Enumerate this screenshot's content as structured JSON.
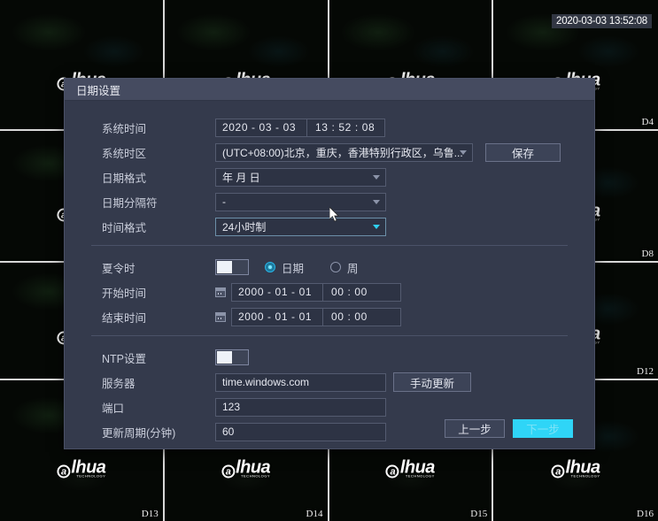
{
  "video_wall": {
    "osd_timestamp": "2020-03-03 13:52:08",
    "logo_text": "lhua",
    "logo_mark": "a",
    "logo_sub": "TECHNOLOGY",
    "channels": [
      {
        "label": ""
      },
      {
        "label": ""
      },
      {
        "label": ""
      },
      {
        "label": "D4"
      },
      {
        "label": ""
      },
      {
        "label": ""
      },
      {
        "label": ""
      },
      {
        "label": "D8"
      },
      {
        "label": ""
      },
      {
        "label": ""
      },
      {
        "label": ""
      },
      {
        "label": "D12"
      },
      {
        "label": "D13"
      },
      {
        "label": "D14"
      },
      {
        "label": "D15"
      },
      {
        "label": "D16"
      }
    ]
  },
  "dialog": {
    "title": "日期设置",
    "system_time": {
      "label": "系统时间",
      "date_value": "2020 - 03 - 03",
      "time_value": "13 : 52 : 08"
    },
    "timezone": {
      "label": "系统时区",
      "value": "(UTC+08:00)北京，重庆，香港特别行政区，乌鲁...",
      "save_label": "保存"
    },
    "date_format": {
      "label": "日期格式",
      "value": "年 月 日"
    },
    "date_separator": {
      "label": "日期分隔符",
      "value": "-"
    },
    "time_format": {
      "label": "时间格式",
      "value": "24小时制"
    },
    "dst": {
      "label": "夏令时",
      "enabled": false,
      "mode_date_label": "日期",
      "mode_week_label": "周",
      "selected_mode": "日期",
      "start": {
        "label": "开始时间",
        "date_value": "2000 - 01 - 01",
        "time_value": "00 : 00"
      },
      "end": {
        "label": "结束时间",
        "date_value": "2000 - 01 - 01",
        "time_value": "00 : 00"
      }
    },
    "ntp": {
      "label": "NTP设置",
      "enabled": false,
      "server": {
        "label": "服务器",
        "value": "time.windows.com",
        "manual_update_label": "手动更新"
      },
      "port": {
        "label": "端口",
        "value": "123"
      },
      "interval": {
        "label": "更新周期(分钟)",
        "value": "60"
      }
    },
    "footer": {
      "prev_label": "上一步",
      "next_label": "下一步"
    }
  },
  "colors": {
    "dialog_bg": "#343a4c",
    "title_bg": "#454b60",
    "accent_cyan": "#2fd5f7",
    "field_bg": "#2d3344",
    "border": "#545b70"
  }
}
